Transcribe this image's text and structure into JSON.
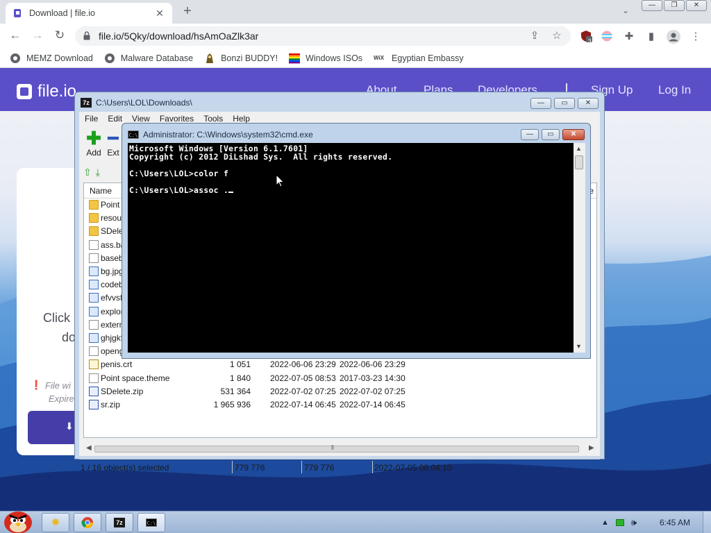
{
  "browser": {
    "tab_title": "Download | file.io",
    "tab_close": "✕",
    "new_tab": "+",
    "tab_dropdown": "⌄",
    "window_controls": {
      "minimize": "—",
      "restore": "❐",
      "close": "✕"
    },
    "url": "file.io/5Qky/download/hsAmOaZlk3ar",
    "extension_badge": "3",
    "bookmarks": [
      {
        "label": "MEMZ Download",
        "icon": "globe-icon"
      },
      {
        "label": "Malware Database",
        "icon": "globe-icon"
      },
      {
        "label": "Bonzi BUDDY!",
        "icon": "bonzi-icon"
      },
      {
        "label": "Windows ISOs",
        "icon": "windows-flag-icon"
      },
      {
        "label": "Egyptian Embassy",
        "icon": "wix-icon"
      }
    ],
    "wix_text": "WiX"
  },
  "site": {
    "logo": "file.io",
    "nav": [
      "About",
      "Plans",
      "Developers",
      "Sign Up",
      "Log In"
    ],
    "card_text": [
      "Click",
      "do"
    ],
    "card_note": [
      "File wi",
      "Expire"
    ]
  },
  "zip": {
    "title": "C:\\Users\\LOL\\Downloads\\",
    "window_controls": {
      "minimize": "—",
      "restore": "▭",
      "close": "✕"
    },
    "menu": [
      "File",
      "Edit",
      "View",
      "Favorites",
      "Tools",
      "Help"
    ],
    "toolbar": [
      {
        "label": "Add"
      },
      {
        "label": "Ext"
      }
    ],
    "columns": {
      "name": "Name",
      "right_fragment": "ile"
    },
    "files": [
      {
        "name": "Point s",
        "size": "",
        "modified": "",
        "created": "",
        "icon": "folder"
      },
      {
        "name": "resourc",
        "size": "",
        "modified": "",
        "created": "",
        "icon": "folder"
      },
      {
        "name": "SDelete",
        "size": "",
        "modified": "",
        "created": "",
        "icon": "folder"
      },
      {
        "name": "ass.bat",
        "size": "",
        "modified": "",
        "created": "",
        "icon": "file"
      },
      {
        "name": "basebr",
        "size": "",
        "modified": "",
        "created": "",
        "icon": "file"
      },
      {
        "name": "bg.jpg",
        "size": "",
        "modified": "",
        "created": "",
        "icon": "img"
      },
      {
        "name": "codebl",
        "size": "",
        "modified": "",
        "created": "",
        "icon": "img"
      },
      {
        "name": "efvvsfd",
        "size": "",
        "modified": "",
        "created": "",
        "icon": "img"
      },
      {
        "name": "explore",
        "size": "",
        "modified": "",
        "created": "",
        "icon": "img"
      },
      {
        "name": "extern",
        "size": "",
        "modified": "",
        "created": "",
        "icon": "file"
      },
      {
        "name": "ghjgkfl",
        "size": "",
        "modified": "",
        "created": "",
        "icon": "img"
      },
      {
        "name": "opengl",
        "size": "",
        "modified": "",
        "created": "",
        "icon": "file"
      },
      {
        "name": "penis.crt",
        "size": "1 051",
        "modified": "2022-06-06 23:29",
        "created": "2022-06-06 23:29",
        "icon": "cert"
      },
      {
        "name": "Point space.theme",
        "size": "1 840",
        "modified": "2022-07-05 08:53",
        "created": "2017-03-23 14:30",
        "icon": "file"
      },
      {
        "name": "SDelete.zip",
        "size": "531 364",
        "modified": "2022-07-02 07:25",
        "created": "2022-07-02 07:25",
        "icon": "zip"
      },
      {
        "name": "sr.zip",
        "size": "1 965 936",
        "modified": "2022-07-14 06:45",
        "created": "2022-07-14 06:45",
        "icon": "zip"
      }
    ],
    "status": {
      "selected": "1 / 16 object(s) selected",
      "size": "779 776",
      "packed": "779 776",
      "date": "2022-07-05 08:04:10"
    }
  },
  "cmd": {
    "title": "Administrator: C:\\Windows\\system32\\cmd.exe",
    "lines": [
      "Microsoft Windows [Version 6.1.7601]",
      "Copyright (c) 2012 DiLshad Sys.  All rights reserved.",
      "",
      "C:\\Users\\LOL>color f",
      "",
      "C:\\Users\\LOL>assoc ."
    ]
  },
  "taskbar": {
    "clock": "6:45 AM",
    "apps": [
      "folder",
      "chrome",
      "7zip",
      "cmd"
    ]
  },
  "colors": {
    "site_purple": "#5b4fc8",
    "console_bg": "#000000",
    "taskbar": "#b9cce4"
  }
}
